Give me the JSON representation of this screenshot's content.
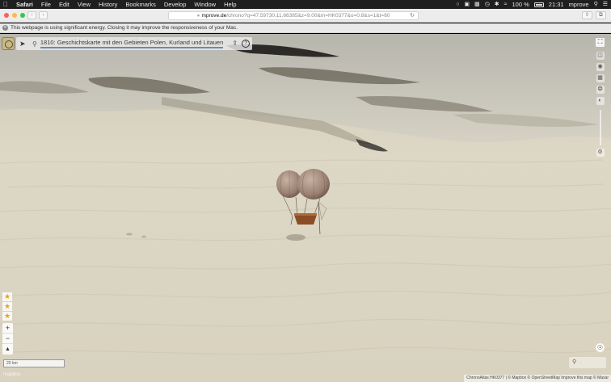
{
  "menubar": {
    "app_name": "Safari",
    "items": [
      "File",
      "Edit",
      "View",
      "History",
      "Bookmarks",
      "Develop",
      "Window",
      "Help"
    ],
    "battery": "100 %",
    "time": "21:31",
    "user": "mprove"
  },
  "browser": {
    "url_domain": "mprove.de",
    "url_path": "/chrono?q=47.59730,11.66385&z=9.00&m=HK0377&o=0.8&s=1&t=60",
    "energy_warning": "This webpage is using significant energy. Closing it may improve the responsiveness of your Mac."
  },
  "map": {
    "title": "1810: Geschichtskarte mit den Gebieten Polen, Kurland und Litauen",
    "scale_label": "20 km",
    "logo_text": "mapbox",
    "search_placeholder": "...",
    "attribution": "ChronoAtlas HK0377 | © Mapbox © OpenStreetMap Improve this map © Maxar",
    "favorites_count": 3
  },
  "icons": {
    "apple": "apple-icon",
    "share": "share-icon",
    "help": "help-icon",
    "fullscreen": "fullscreen-icon",
    "locate": "locate-icon",
    "search": "search-icon"
  },
  "colors": {
    "accent": "#6a89b8",
    "star": "#e7a21d",
    "sand": "#d9d4c4"
  }
}
